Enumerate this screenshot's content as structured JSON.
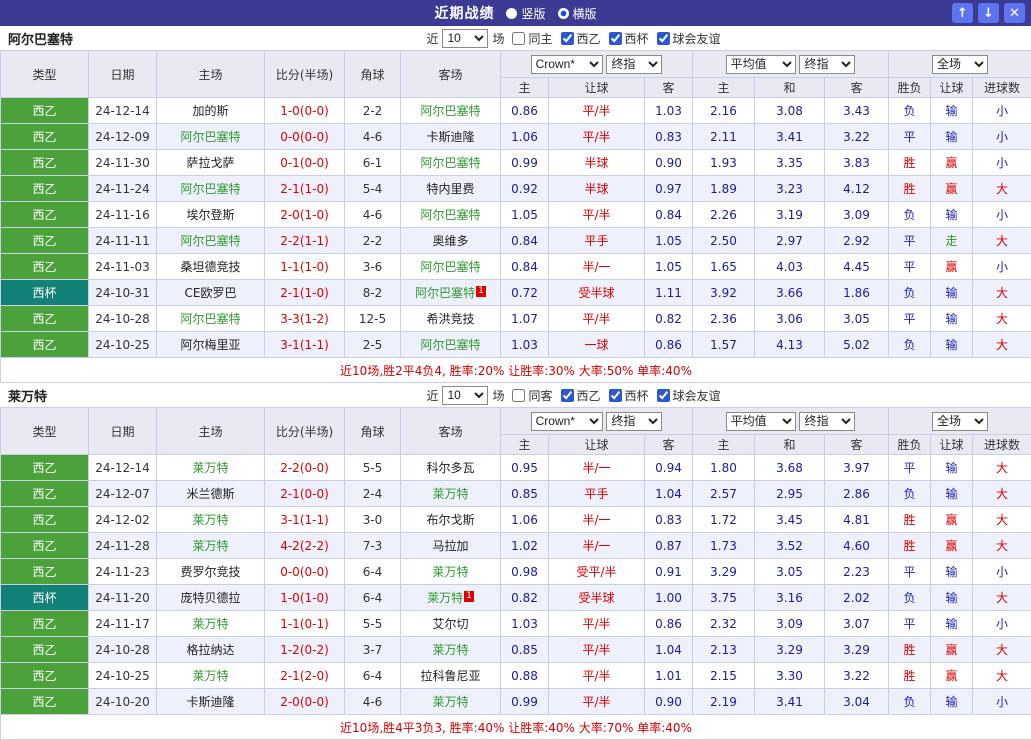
{
  "topbar": {
    "title": "近期战绩",
    "view_options": [
      {
        "label": "竖版",
        "selected": false
      },
      {
        "label": "横版",
        "selected": true
      }
    ],
    "icons": {
      "up": "↑",
      "down": "↓",
      "close": "✕"
    }
  },
  "labels": {
    "near": "近",
    "unit": "场"
  },
  "headers": {
    "type": "类型",
    "date": "日期",
    "home": "主场",
    "score": "比分(半场)",
    "corner": "角球",
    "away": "客场",
    "odds_home": "主",
    "odds_handicap": "让球",
    "odds_away": "客",
    "avg_home": "主",
    "avg_draw": "和",
    "avg_away": "客",
    "result": "胜负",
    "handicap_result": "让球",
    "goals": "进球数"
  },
  "dropdowns": {
    "count": "10",
    "bookmaker": "Crown*",
    "final_odds": "终指",
    "average": "平均值",
    "full_match": "全场"
  },
  "league_colors": {
    "西乙": "#4ba23a",
    "西杯": "#128277"
  },
  "result_colors": {
    "胜": "#e00000",
    "负": "#2222bb",
    "平": "#2222bb",
    "赢": "#e00000",
    "输": "#2222bb",
    "走": "#2e9b2e",
    "大": "#e00000",
    "小": "#2222bb"
  },
  "sections": [
    {
      "team": "阿尔巴塞特",
      "filter": {
        "same_label": "同主",
        "same_checked": false,
        "leagues": [
          {
            "label": "西乙",
            "checked": true
          },
          {
            "label": "西杯",
            "checked": true
          },
          {
            "label": "球会友谊",
            "checked": true
          }
        ]
      },
      "rows": [
        {
          "league": "西乙",
          "date": "24-12-14",
          "home": "加的斯",
          "home_focal": false,
          "score": "1-0(0-0)",
          "corner": "2-2",
          "away": "阿尔巴塞特",
          "away_focal": true,
          "red_side": "",
          "red_count": "",
          "odds": [
            "0.86",
            "平/半",
            "1.03"
          ],
          "avg": [
            "2.16",
            "3.08",
            "3.43"
          ],
          "results": [
            "负",
            "输",
            "小"
          ]
        },
        {
          "league": "西乙",
          "date": "24-12-09",
          "home": "阿尔巴塞特",
          "home_focal": true,
          "score": "0-0(0-0)",
          "corner": "4-6",
          "away": "卡斯迪隆",
          "away_focal": false,
          "red_side": "",
          "red_count": "",
          "odds": [
            "1.06",
            "平/半",
            "0.83"
          ],
          "avg": [
            "2.11",
            "3.41",
            "3.22"
          ],
          "results": [
            "平",
            "输",
            "小"
          ]
        },
        {
          "league": "西乙",
          "date": "24-11-30",
          "home": "萨拉戈萨",
          "home_focal": false,
          "score": "0-1(0-0)",
          "corner": "6-1",
          "away": "阿尔巴塞特",
          "away_focal": true,
          "red_side": "",
          "red_count": "",
          "odds": [
            "0.99",
            "半球",
            "0.90"
          ],
          "avg": [
            "1.93",
            "3.35",
            "3.83"
          ],
          "results": [
            "胜",
            "赢",
            "小"
          ]
        },
        {
          "league": "西乙",
          "date": "24-11-24",
          "home": "阿尔巴塞特",
          "home_focal": true,
          "score": "2-1(1-0)",
          "corner": "5-4",
          "away": "特内里费",
          "away_focal": false,
          "red_side": "",
          "red_count": "",
          "odds": [
            "0.92",
            "半球",
            "0.97"
          ],
          "avg": [
            "1.89",
            "3.23",
            "4.12"
          ],
          "results": [
            "胜",
            "赢",
            "大"
          ]
        },
        {
          "league": "西乙",
          "date": "24-11-16",
          "home": "埃尔登斯",
          "home_focal": false,
          "score": "2-0(1-0)",
          "corner": "4-6",
          "away": "阿尔巴塞特",
          "away_focal": true,
          "red_side": "",
          "red_count": "",
          "odds": [
            "1.05",
            "平/半",
            "0.84"
          ],
          "avg": [
            "2.26",
            "3.19",
            "3.09"
          ],
          "results": [
            "负",
            "输",
            "小"
          ]
        },
        {
          "league": "西乙",
          "date": "24-11-11",
          "home": "阿尔巴塞特",
          "home_focal": true,
          "score": "2-2(1-1)",
          "corner": "2-2",
          "away": "奥维多",
          "away_focal": false,
          "red_side": "",
          "red_count": "",
          "odds": [
            "0.84",
            "平手",
            "1.05"
          ],
          "avg": [
            "2.50",
            "2.97",
            "2.92"
          ],
          "results": [
            "平",
            "走",
            "大"
          ]
        },
        {
          "league": "西乙",
          "date": "24-11-03",
          "home": "桑坦德竞技",
          "home_focal": false,
          "score": "1-1(1-0)",
          "corner": "3-6",
          "away": "阿尔巴塞特",
          "away_focal": true,
          "red_side": "",
          "red_count": "",
          "odds": [
            "0.84",
            "半/一",
            "1.05"
          ],
          "avg": [
            "1.65",
            "4.03",
            "4.45"
          ],
          "results": [
            "平",
            "赢",
            "小"
          ]
        },
        {
          "league": "西杯",
          "date": "24-10-31",
          "home": "CE欧罗巴",
          "home_focal": false,
          "score": "2-1(1-0)",
          "corner": "8-2",
          "away": "阿尔巴塞特",
          "away_focal": true,
          "red_side": "away",
          "red_count": "1",
          "odds": [
            "0.72",
            "受半球",
            "1.11"
          ],
          "avg": [
            "3.92",
            "3.66",
            "1.86"
          ],
          "results": [
            "负",
            "输",
            "大"
          ]
        },
        {
          "league": "西乙",
          "date": "24-10-28",
          "home": "阿尔巴塞特",
          "home_focal": true,
          "score": "3-3(1-2)",
          "corner": "12-5",
          "away": "希洪竞技",
          "away_focal": false,
          "red_side": "",
          "red_count": "",
          "odds": [
            "1.07",
            "平/半",
            "0.82"
          ],
          "avg": [
            "2.36",
            "3.06",
            "3.05"
          ],
          "results": [
            "平",
            "输",
            "大"
          ]
        },
        {
          "league": "西乙",
          "date": "24-10-25",
          "home": "阿尔梅里亚",
          "home_focal": false,
          "score": "3-1(1-1)",
          "corner": "2-5",
          "away": "阿尔巴塞特",
          "away_focal": true,
          "red_side": "",
          "red_count": "",
          "odds": [
            "1.03",
            "一球",
            "0.86"
          ],
          "avg": [
            "1.57",
            "4.13",
            "5.02"
          ],
          "results": [
            "负",
            "输",
            "大"
          ]
        }
      ],
      "summary": "近10场,胜2平4负4, 胜率:20% 让胜率:30% 大率:50% 单率:40%"
    },
    {
      "team": "莱万特",
      "filter": {
        "same_label": "同客",
        "same_checked": false,
        "leagues": [
          {
            "label": "西乙",
            "checked": true
          },
          {
            "label": "西杯",
            "checked": true
          },
          {
            "label": "球会友谊",
            "checked": true
          }
        ]
      },
      "rows": [
        {
          "league": "西乙",
          "date": "24-12-14",
          "home": "莱万特",
          "home_focal": true,
          "score": "2-2(0-0)",
          "corner": "5-5",
          "away": "科尔多瓦",
          "away_focal": false,
          "red_side": "",
          "red_count": "",
          "odds": [
            "0.95",
            "半/一",
            "0.94"
          ],
          "avg": [
            "1.80",
            "3.68",
            "3.97"
          ],
          "results": [
            "平",
            "输",
            "大"
          ]
        },
        {
          "league": "西乙",
          "date": "24-12-07",
          "home": "米兰德斯",
          "home_focal": false,
          "score": "2-1(0-0)",
          "corner": "2-4",
          "away": "莱万特",
          "away_focal": true,
          "red_side": "",
          "red_count": "",
          "odds": [
            "0.85",
            "平手",
            "1.04"
          ],
          "avg": [
            "2.57",
            "2.95",
            "2.86"
          ],
          "results": [
            "负",
            "输",
            "大"
          ]
        },
        {
          "league": "西乙",
          "date": "24-12-02",
          "home": "莱万特",
          "home_focal": true,
          "score": "3-1(1-1)",
          "corner": "3-0",
          "away": "布尔戈斯",
          "away_focal": false,
          "red_side": "",
          "red_count": "",
          "odds": [
            "1.06",
            "半/一",
            "0.83"
          ],
          "avg": [
            "1.72",
            "3.45",
            "4.81"
          ],
          "results": [
            "胜",
            "赢",
            "大"
          ]
        },
        {
          "league": "西乙",
          "date": "24-11-28",
          "home": "莱万特",
          "home_focal": true,
          "score": "4-2(2-2)",
          "corner": "7-3",
          "away": "马拉加",
          "away_focal": false,
          "red_side": "",
          "red_count": "",
          "odds": [
            "1.02",
            "半/一",
            "0.87"
          ],
          "avg": [
            "1.73",
            "3.52",
            "4.60"
          ],
          "results": [
            "胜",
            "赢",
            "大"
          ]
        },
        {
          "league": "西乙",
          "date": "24-11-23",
          "home": "费罗尔竞技",
          "home_focal": false,
          "score": "0-0(0-0)",
          "corner": "6-4",
          "away": "莱万特",
          "away_focal": true,
          "red_side": "",
          "red_count": "",
          "odds": [
            "0.98",
            "受平/半",
            "0.91"
          ],
          "avg": [
            "3.29",
            "3.05",
            "2.23"
          ],
          "results": [
            "平",
            "输",
            "小"
          ]
        },
        {
          "league": "西杯",
          "date": "24-11-20",
          "home": "庞特贝德拉",
          "home_focal": false,
          "score": "1-0(1-0)",
          "corner": "6-4",
          "away": "莱万特",
          "away_focal": true,
          "red_side": "away",
          "red_count": "1",
          "odds": [
            "0.82",
            "受半球",
            "1.00"
          ],
          "avg": [
            "3.75",
            "3.16",
            "2.02"
          ],
          "results": [
            "负",
            "输",
            "大"
          ]
        },
        {
          "league": "西乙",
          "date": "24-11-17",
          "home": "莱万特",
          "home_focal": true,
          "score": "1-1(0-1)",
          "corner": "5-5",
          "away": "艾尔切",
          "away_focal": false,
          "red_side": "",
          "red_count": "",
          "odds": [
            "1.03",
            "平/半",
            "0.86"
          ],
          "avg": [
            "2.32",
            "3.09",
            "3.07"
          ],
          "results": [
            "平",
            "输",
            "小"
          ]
        },
        {
          "league": "西乙",
          "date": "24-10-28",
          "home": "格拉纳达",
          "home_focal": false,
          "score": "1-2(0-2)",
          "corner": "3-7",
          "away": "莱万特",
          "away_focal": true,
          "red_side": "",
          "red_count": "",
          "odds": [
            "0.85",
            "平/半",
            "1.04"
          ],
          "avg": [
            "2.13",
            "3.29",
            "3.29"
          ],
          "results": [
            "胜",
            "赢",
            "大"
          ]
        },
        {
          "league": "西乙",
          "date": "24-10-25",
          "home": "莱万特",
          "home_focal": true,
          "score": "2-1(2-0)",
          "corner": "6-4",
          "away": "拉科鲁尼亚",
          "away_focal": false,
          "red_side": "",
          "red_count": "",
          "odds": [
            "0.88",
            "平/半",
            "1.01"
          ],
          "avg": [
            "2.15",
            "3.30",
            "3.22"
          ],
          "results": [
            "胜",
            "赢",
            "大"
          ]
        },
        {
          "league": "西乙",
          "date": "24-10-20",
          "home": "卡斯迪隆",
          "home_focal": false,
          "score": "2-0(0-0)",
          "corner": "4-6",
          "away": "莱万特",
          "away_focal": true,
          "red_side": "",
          "red_count": "",
          "odds": [
            "0.99",
            "平/半",
            "0.90"
          ],
          "avg": [
            "2.19",
            "3.41",
            "3.04"
          ],
          "results": [
            "负",
            "输",
            "小"
          ]
        }
      ],
      "summary": "近10场,胜4平3负3, 胜率:40% 让胜率:40% 大率:70% 单率:40%"
    }
  ]
}
